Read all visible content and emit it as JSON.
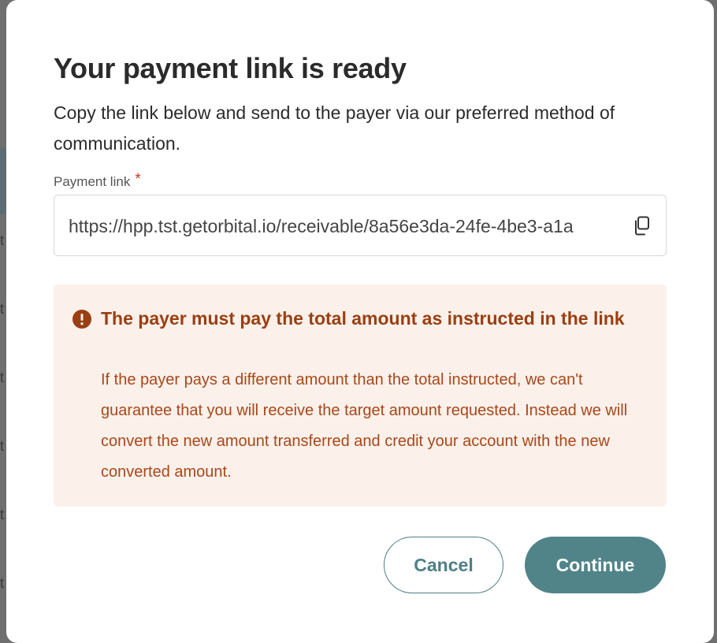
{
  "modal": {
    "title": "Your payment link is ready",
    "subtitle": "Copy the link below and send to the payer via our preferred method of communication.",
    "field": {
      "label": "Payment link",
      "required_mark": "*",
      "value": "https://hpp.tst.getorbital.io/receivable/8a56e3da-24fe-4be3-a1a",
      "copy_icon": "copy-icon"
    },
    "alert": {
      "icon": "exclamation-circle-icon",
      "title": "The payer must pay the total amount as instructed in the link",
      "body": "If the payer pays a different amount than the total instructed, we can't guarantee that you will receive the target amount requested. Instead we will convert the new amount transferred and credit your account with the new converted amount."
    },
    "buttons": {
      "cancel": "Cancel",
      "continue": "Continue"
    }
  },
  "colors": {
    "accent": "#518489",
    "warning_text": "#9a3f12",
    "warning_bg": "#fbf0ea",
    "overlay": "#7a7a7a"
  }
}
